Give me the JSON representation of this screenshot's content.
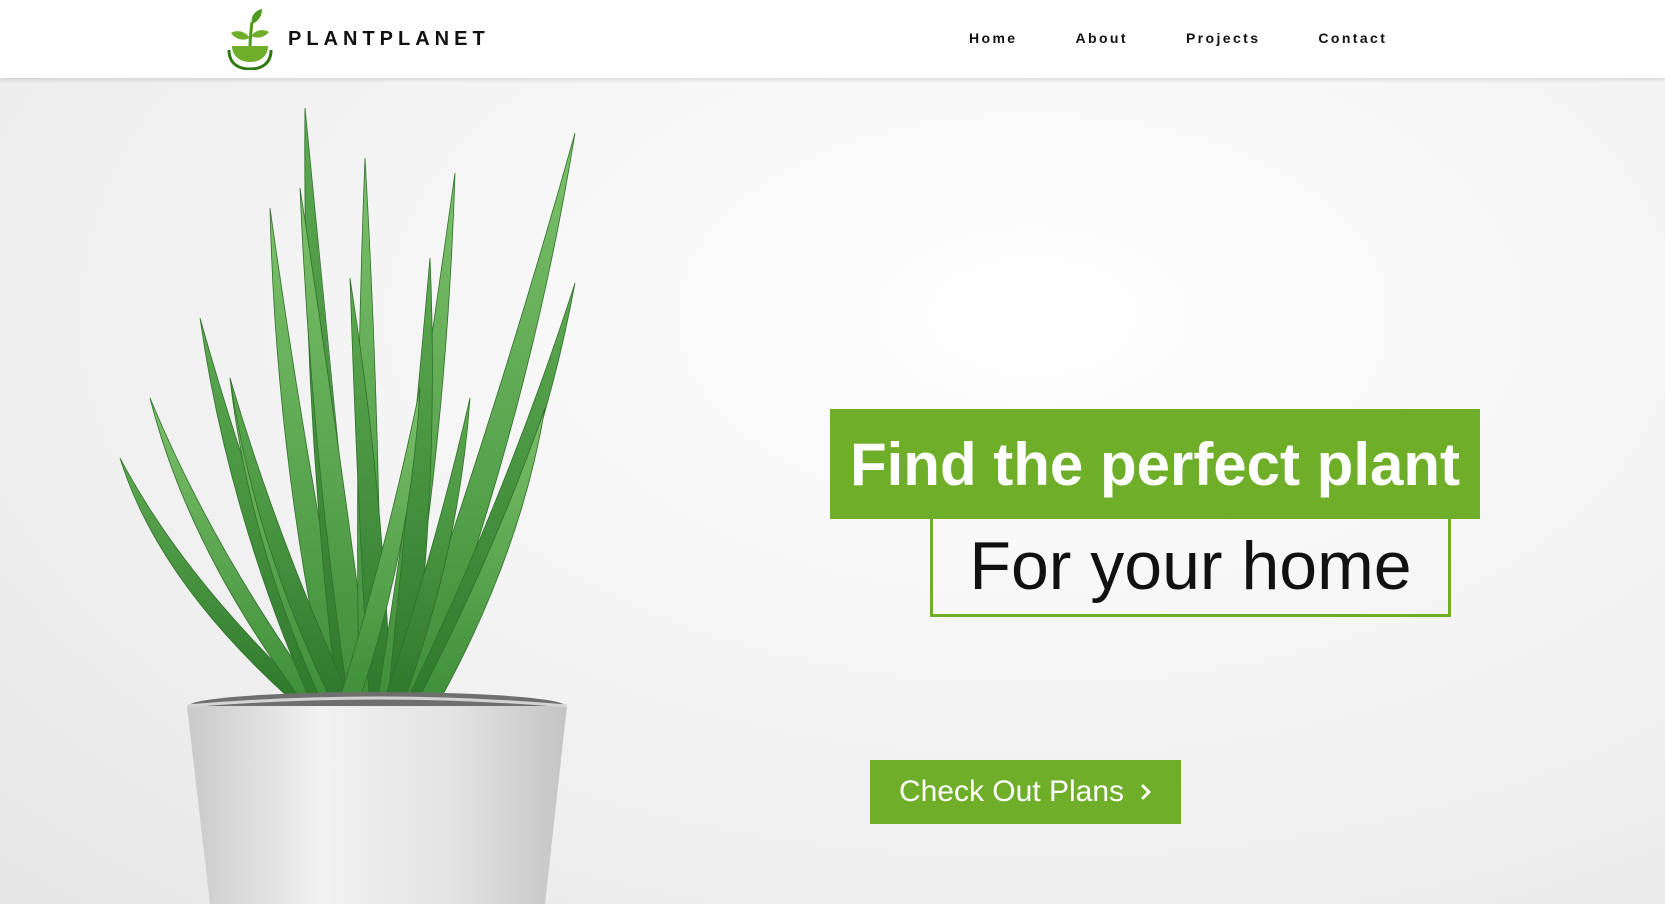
{
  "brand": {
    "name": "PLANTPLANET",
    "logo_icon": "sprout-bowl-icon"
  },
  "nav": {
    "items": [
      {
        "label": "Home"
      },
      {
        "label": "About"
      },
      {
        "label": "Projects"
      },
      {
        "label": "Contact"
      }
    ]
  },
  "hero": {
    "headline": "Find the perfect plant",
    "subheadline": "For your home",
    "image": "aloe-vera-potted-plant",
    "cta": {
      "label": "Check Out Plans",
      "icon": "chevron-right-icon"
    }
  },
  "colors": {
    "accent": "#6fae28",
    "text": "#111111",
    "header_bg": "#ffffff",
    "hero_bg": "#efefef"
  }
}
